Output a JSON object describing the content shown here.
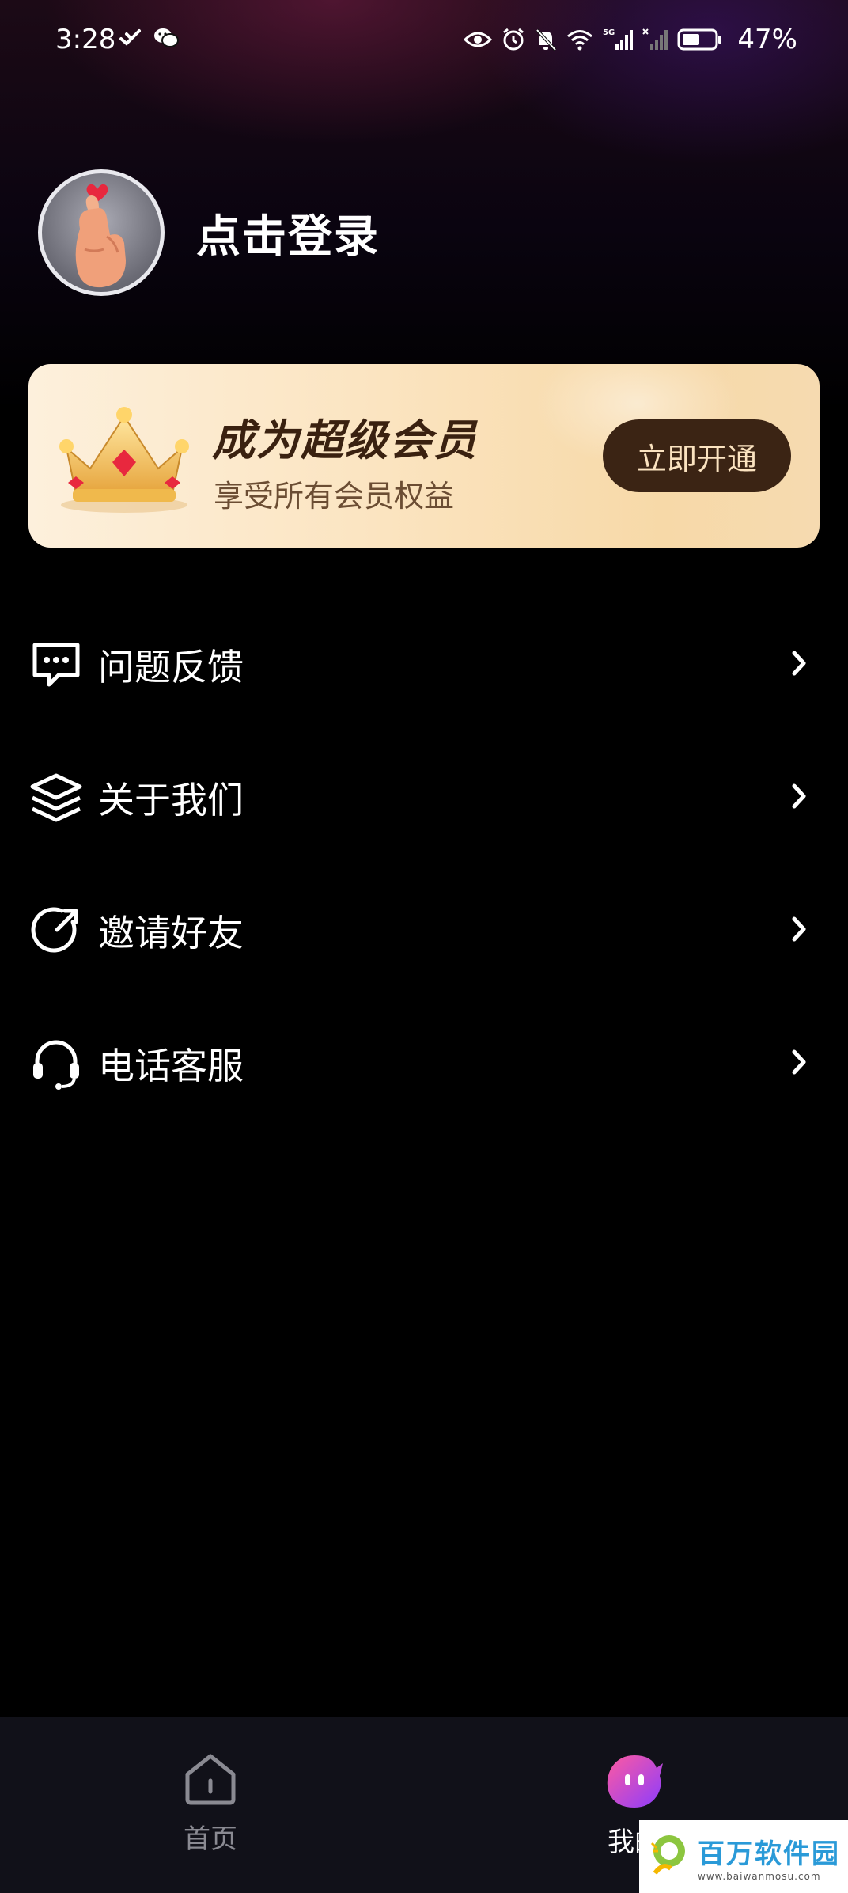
{
  "status_bar": {
    "time": "3:28",
    "battery": "47%",
    "network_label": "5G"
  },
  "profile": {
    "login_label": "点击登录"
  },
  "vip": {
    "title": "成为超级会员",
    "subtitle": "享受所有会员权益",
    "button_label": "立即开通"
  },
  "menu": {
    "items": [
      {
        "label": "问题反馈",
        "icon": "chat-bubble-icon"
      },
      {
        "label": "关于我们",
        "icon": "layers-icon"
      },
      {
        "label": "邀请好友",
        "icon": "share-arrow-icon"
      },
      {
        "label": "电话客服",
        "icon": "headset-icon"
      }
    ]
  },
  "tab_bar": {
    "home_label": "首页",
    "mine_label": "我的"
  },
  "watermark": {
    "text": "百万软件园",
    "url": "www.baiwanmosu.com"
  },
  "colors": {
    "vip_button_bg": "#3b2414",
    "vip_text": "#3a2110",
    "tab_active_from": "#ff5aa0",
    "tab_active_to": "#8a3cff"
  }
}
